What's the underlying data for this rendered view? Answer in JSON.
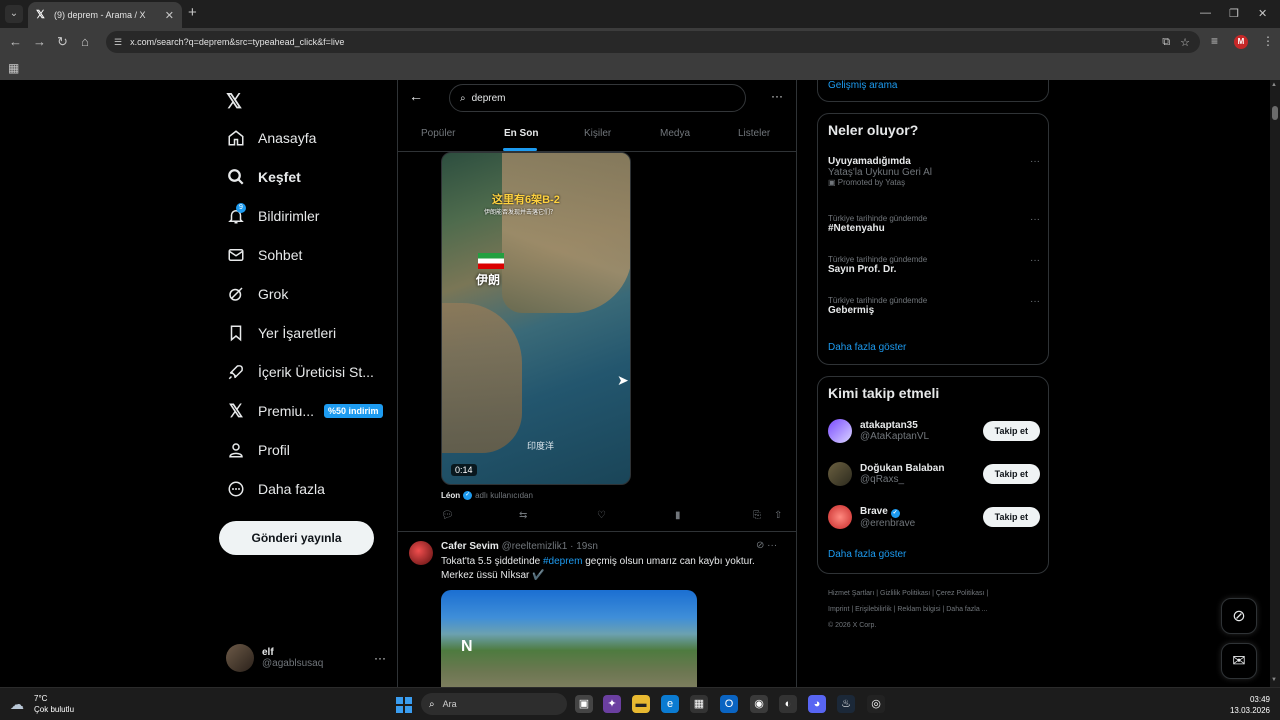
{
  "browser": {
    "tab_title": "(9) deprem - Arama / X",
    "url": "x.com/search?q=deprem&src=typeahead_click&f=live",
    "profile_initial": "M"
  },
  "nav": {
    "items": [
      {
        "label": "Anasayfa",
        "icon": "home-icon"
      },
      {
        "label": "Keşfet",
        "icon": "search-icon"
      },
      {
        "label": "Bildirimler",
        "icon": "bell-icon",
        "badge": "9"
      },
      {
        "label": "Sohbet",
        "icon": "mail-icon"
      },
      {
        "label": "Grok",
        "icon": "grok-icon"
      },
      {
        "label": "Yer İşaretleri",
        "icon": "bookmark-icon"
      },
      {
        "label": "İçerik Üreticisi St...",
        "icon": "rocket-icon"
      },
      {
        "label": "Premiu...",
        "icon": "x-icon",
        "badge": "%50 indirim"
      },
      {
        "label": "Profil",
        "icon": "person-icon"
      },
      {
        "label": "Daha fazla",
        "icon": "more-circle-icon"
      }
    ],
    "post_button": "Gönderi yayınla",
    "account": {
      "name": "elf",
      "handle": "@agablsusaq"
    }
  },
  "search": {
    "value": "deprem",
    "tabs": [
      "Popüler",
      "En Son",
      "Kişiler",
      "Medya",
      "Listeler"
    ],
    "active_tab": "En Son"
  },
  "tweet1": {
    "video": {
      "caption": "这里有6架B-2",
      "subcaption": "伊朗能否发现并击落它们？",
      "country_label": "伊朗",
      "ocean_label": "印度洋",
      "duration": "0:14"
    },
    "credit_name": "Léon",
    "credit_suffix": "adlı kullanıcıdan"
  },
  "tweet2": {
    "name": "Cafer Sevim",
    "handle": "@reeltemizlik1",
    "time": "· 19sn",
    "text_before": "Tokat'ta 5.5 şiddetinde ",
    "hashtag": "#deprem",
    "text_after": " geçmiş olsun umarız can kaybı yoktur.",
    "line2": "Merkez üssü  Nİksar ✔️",
    "image_logo": "N"
  },
  "right": {
    "advanced_search": "Gelişmiş arama",
    "trends_title": "Neler oluyor?",
    "trends": [
      {
        "meta": "",
        "name": "Uyuyamadığımda",
        "desc": "Yataş'la Uykunu Geri Al",
        "promoted": "Promoted by Yataş"
      },
      {
        "meta": "Türkiye tarihinde gündemde",
        "name": "#Netenyahu"
      },
      {
        "meta": "Türkiye tarihinde gündemde",
        "name": "Sayın Prof. Dr."
      },
      {
        "meta": "Türkiye tarihinde gündemde",
        "name": "Gebermiş"
      }
    ],
    "trends_more": "Daha fazla göster",
    "follow_title": "Kimi takip etmeli",
    "follow": [
      {
        "name": "atakaptan35",
        "handle": "@AtaKaptanVL",
        "button": "Takip et"
      },
      {
        "name": "Doğukan Balaban",
        "handle": "@qRaxs_",
        "button": "Takip et"
      },
      {
        "name": "Brave",
        "handle": "@erenbrave",
        "button": "Takip et"
      }
    ],
    "follow_more": "Daha fazla göster",
    "footer_line1": "Hizmet Şartları  |  Gizlilik Politikası  |  Çerez Politikası  |",
    "footer_line2": "Imprint  |  Erişilebilirlik  |  Reklam bilgisi  |  Daha fazla ...",
    "footer_line3": "© 2026 X Corp."
  },
  "taskbar": {
    "temp": "7°C",
    "weather": "Çok bulutlu",
    "search_placeholder": "Ara",
    "time": "03:49",
    "date": "13.03.2026"
  }
}
